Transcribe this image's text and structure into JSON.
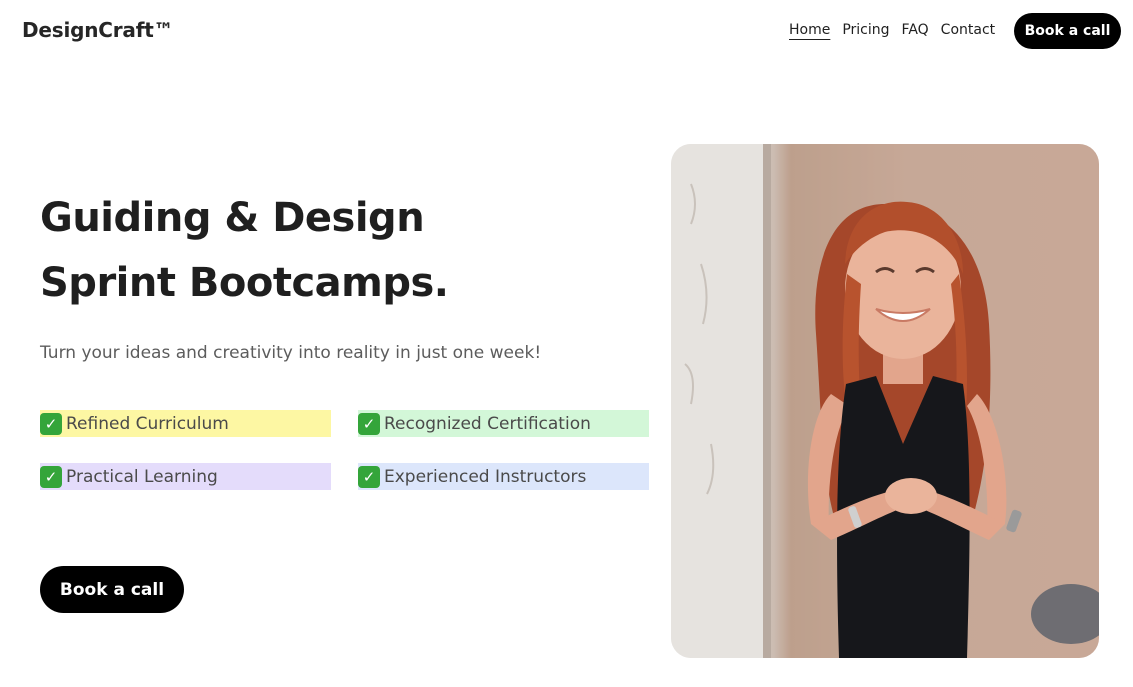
{
  "header": {
    "logo": "DesignCraft™",
    "nav": [
      {
        "label": "Home",
        "active": true
      },
      {
        "label": "Pricing",
        "active": false
      },
      {
        "label": "FAQ",
        "active": false
      },
      {
        "label": "Contact",
        "active": false
      }
    ],
    "cta_label": "Book a call"
  },
  "hero": {
    "headline_line1": "Guiding & Design",
    "headline_line2": "Sprint Bootcamps.",
    "subtitle": "Turn your ideas and creativity into reality in just one week!",
    "features": [
      {
        "check": "✓",
        "label": "Refined Curriculum",
        "color": "#fdf7a3"
      },
      {
        "check": "✓",
        "label": "Recognized Certification",
        "color": "#d3f7d8"
      },
      {
        "check": "✓",
        "label": "Practical Learning",
        "color": "#e4dcfb"
      },
      {
        "check": "✓",
        "label": "Experienced Instructors",
        "color": "#dce6fb"
      }
    ],
    "cta_label": "Book a call",
    "photo_icon": "smiling-instructor-photo"
  },
  "colors": {
    "accent": "#000000",
    "check_green": "#34a53a"
  }
}
